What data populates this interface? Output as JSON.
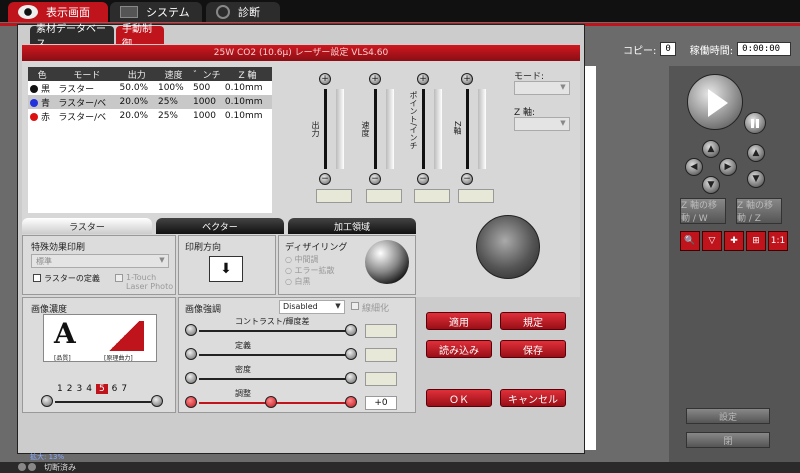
{
  "top_tabs": [
    {
      "label": "表示画面",
      "active": true
    },
    {
      "label": "システム",
      "active": false
    },
    {
      "label": "診断",
      "active": false
    }
  ],
  "status": {
    "copy_label": "コピー:",
    "copy_value": "0",
    "time_label": "稼働時間:",
    "time_value": "0:00:00"
  },
  "dialog": {
    "tabs": [
      "素材データベース",
      "手動制御"
    ],
    "title": "25W CO2 (10.6μ) レーザー設定 VLS4.60",
    "table": {
      "headers": [
        "色",
        "モード",
        "出力",
        "速度",
        "゛ンチ",
        "Z 軸"
      ],
      "rows": [
        {
          "color": "#111111",
          "name": "黒",
          "mode": "ラスター",
          "power": "50.0%",
          "speed": "100%",
          "ppi": "500",
          "z": "0.10mm"
        },
        {
          "color": "#2233dd",
          "name": "青",
          "mode": "ラスター/ベ",
          "power": "20.0%",
          "speed": "25%",
          "ppi": "1000",
          "z": "0.10mm"
        },
        {
          "color": "#dd1111",
          "name": "赤",
          "mode": "ラスター/ベ",
          "power": "20.0%",
          "speed": "25%",
          "ppi": "1000",
          "z": "0.10mm"
        }
      ]
    },
    "sliders": [
      {
        "label": "出力"
      },
      {
        "label": "速度"
      },
      {
        "label": "ポイント/インチ"
      },
      {
        "label": "Z軸"
      }
    ],
    "mode_label": "モード:",
    "zaxis_label": "Z 軸:",
    "lower_tabs": [
      "ラスター",
      "ベクター",
      "加工領域"
    ],
    "raster": {
      "special_effects_label": "特殊効果印刷",
      "special_effects_value": "標準",
      "raster_define_label": "ラスターの定義",
      "onetouch_label": "1-Touch Laser Photo",
      "print_direction_label": "印刷方向",
      "dithering_label": "ディザイリング",
      "dither_options": [
        "中間調",
        "エラー拡散",
        "白黒"
      ],
      "density_label": "画像濃度",
      "density_caption_left": "[品質]",
      "density_caption_right": "[原理曲力]",
      "density_levels": [
        "1",
        "2",
        "3",
        "4",
        "5",
        "6",
        "7"
      ],
      "density_selected": "5",
      "enhance_label": "画像強調",
      "enhance_value": "Disabled",
      "smoothing_label": "線細化",
      "contrast_label": "コントラスト/輝度差",
      "definition_label": "定義",
      "density2_label": "密度",
      "adjust_label": "調整",
      "adjust_value": "+0"
    },
    "buttons": {
      "apply": "適用",
      "standard": "規定",
      "load": "読み込み",
      "save": "保存",
      "ok": "ＯＫ",
      "cancel": "キャンセル"
    }
  },
  "right_panel": {
    "btn1": "Z 軸の移動 / W",
    "btn2": "Z 軸の移動 / Z",
    "settings_label": "設定",
    "close_label": "閉"
  },
  "bottom": {
    "zoom_text": "拡大: 13%",
    "status_text": "切断済み"
  }
}
